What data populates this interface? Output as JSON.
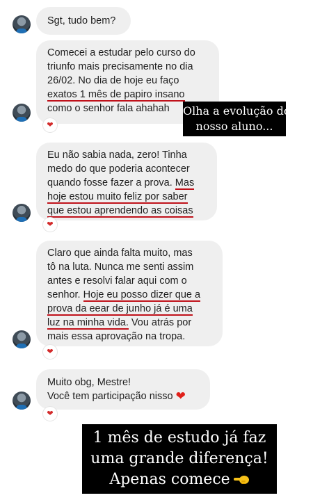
{
  "messages": [
    {
      "text_lines": [
        "Sgt, tudo bem?"
      ]
    },
    {
      "text_lines": [
        "Comecei a estudar pelo curso do",
        "triunfo mais precisamente no dia",
        "26/02. No dia de hoje eu faço",
        "exatos 1 mês de papiro insano",
        "como o senhor fala ahahah"
      ],
      "reaction": "❤"
    },
    {
      "text_lines": [
        "Eu não sabia nada, zero! Tinha",
        "medo do que poderia acontecer",
        "quando fosse fazer a prova. ",
        "Mas",
        "hoje estou muito feliz por saber",
        "que estou aprendendo as coisas"
      ],
      "reaction": "❤"
    },
    {
      "text_lines": [
        "Claro que ainda falta muito, mas",
        "tô na luta. Nunca me senti assim",
        "antes e resolvi falar aqui com o",
        "senhor. ",
        "Hoje eu posso dizer que a",
        "prova da eear de junho já é uma",
        "luz na minha vida.",
        " Vou atrás por",
        "mais essa aprovação na tropa."
      ],
      "reaction": "❤"
    },
    {
      "text_lines": [
        "Muito obg, Mestre!",
        "Você tem participação nisso "
      ],
      "inline_emoji": "❤",
      "reaction": "❤"
    }
  ],
  "overlays": {
    "caption_top": [
      "Olha a evolução do",
      "nosso aluno..."
    ],
    "caption_bottom": [
      "1 mês de estudo já faz",
      "uma grande diferença!",
      "Apenas comece"
    ]
  },
  "colors": {
    "bubble_bg": "#efefef",
    "underline": "#c0111a",
    "heart": "#d32a2a",
    "sticker_bg": "#000000"
  },
  "icons": {
    "avatar": "profile-avatar",
    "reaction": "heart-reaction-icon",
    "emoji": "pointing-hand-icon"
  }
}
